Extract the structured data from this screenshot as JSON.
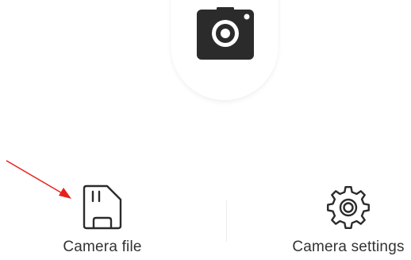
{
  "header": {
    "camera_icon": "camera-icon"
  },
  "actions": [
    {
      "label": "Camera file",
      "icon": "sd-card-icon"
    },
    {
      "label": "Camera settings",
      "icon": "gear-icon"
    }
  ],
  "annotation": {
    "arrow_color": "#e8201c"
  }
}
